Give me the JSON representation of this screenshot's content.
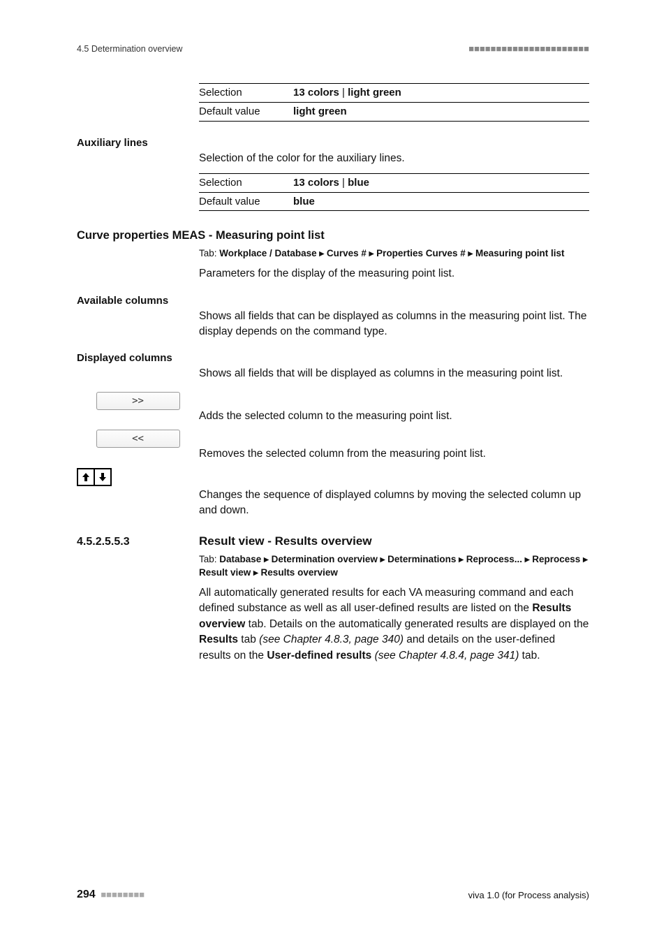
{
  "header": {
    "section": "4.5 Determination overview",
    "squares": "■■■■■■■■■■■■■■■■■■■■■■"
  },
  "block1": {
    "sel_label": "Selection",
    "sel_val_a": "13 colors",
    "sel_val_b": "light green",
    "def_label": "Default value",
    "def_val": "light green"
  },
  "aux": {
    "title": "Auxiliary lines",
    "desc": "Selection of the color for the auxiliary lines.",
    "sel_label": "Selection",
    "sel_val_a": "13 colors",
    "sel_val_b": "blue",
    "def_label": "Default value",
    "def_val": "blue"
  },
  "curve": {
    "title": "Curve properties MEAS - Measuring point list",
    "tab_prefix": "Tab: ",
    "tab_path": "Workplace / Database ▸ Curves # ▸ Properties Curves # ▸ Measuring point list",
    "desc": "Parameters for the display of the measuring point list."
  },
  "avail": {
    "title": "Available columns",
    "desc": "Shows all fields that can be displayed as columns in the measuring point list. The display depends on the command type."
  },
  "disp": {
    "title": "Displayed columns",
    "desc": "Shows all fields that will be displayed as columns in the measuring point list."
  },
  "btn_add": {
    "label": ">>",
    "desc": "Adds the selected column to the measuring point list."
  },
  "btn_remove": {
    "label": "<<",
    "desc": "Removes the selected column from the measuring point list."
  },
  "btn_arrows": {
    "desc": "Changes the sequence of displayed columns by moving the selected column up and down."
  },
  "result": {
    "num": "4.5.2.5.5.3",
    "title": "Result view - Results overview",
    "tab_prefix": "Tab: ",
    "tab_path": "Database ▸ Determination overview ▸ Determinations ▸ Reprocess... ▸ Reprocess ▸ Result view ▸ Results overview",
    "para_a": "All automatically generated results for each VA measuring command and each defined substance as well as all user-defined results are listed on the ",
    "para_b": "Results overview",
    "para_c": " tab. Details on the automatically generated results are displayed on the ",
    "para_d": "Results",
    "para_e": " tab ",
    "para_f": "(see Chapter 4.8.3, page 340)",
    "para_g": " and details on the user-defined results on the ",
    "para_h": "User-defined results",
    "para_i": " ",
    "para_j": "(see Chapter 4.8.4, page 341)",
    "para_k": " tab."
  },
  "footer": {
    "page": "294",
    "squares": "■■■■■■■■",
    "product": "viva 1.0 (for Process analysis)"
  }
}
